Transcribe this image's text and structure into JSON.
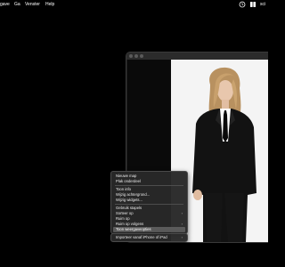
{
  "menubar": {
    "items": [
      {
        "label": "gave"
      },
      {
        "label": "Ga"
      },
      {
        "label": "Venster"
      },
      {
        "label": "Help"
      }
    ],
    "right_text": "sci"
  },
  "context_menu": {
    "items": [
      {
        "label": "Nieuwe map",
        "submenu": false
      },
      {
        "label": "Plak onderdeel",
        "submenu": false
      },
      {
        "label": "Toon info",
        "submenu": false
      },
      {
        "label": "Wijzig achtergrond...",
        "submenu": false
      },
      {
        "label": "Wijzig widgets...",
        "submenu": false
      },
      {
        "label": "Gebruik stapels",
        "submenu": false
      },
      {
        "label": "Sorteer op",
        "submenu": true
      },
      {
        "label": "Ruim op",
        "submenu": false
      },
      {
        "label": "Ruim op volgens",
        "submenu": true
      },
      {
        "label": "Toon weergaveopties",
        "submenu": false,
        "highlighted": true
      },
      {
        "label": "Importeer vanaf iPhone of iPad",
        "submenu": true
      }
    ],
    "submenu_arrow": "›"
  },
  "colors": {
    "desktop": "#000000",
    "menu_bg": "#282828",
    "highlight": "#5b5b5b",
    "photo_bg": "#f3f3f3"
  }
}
